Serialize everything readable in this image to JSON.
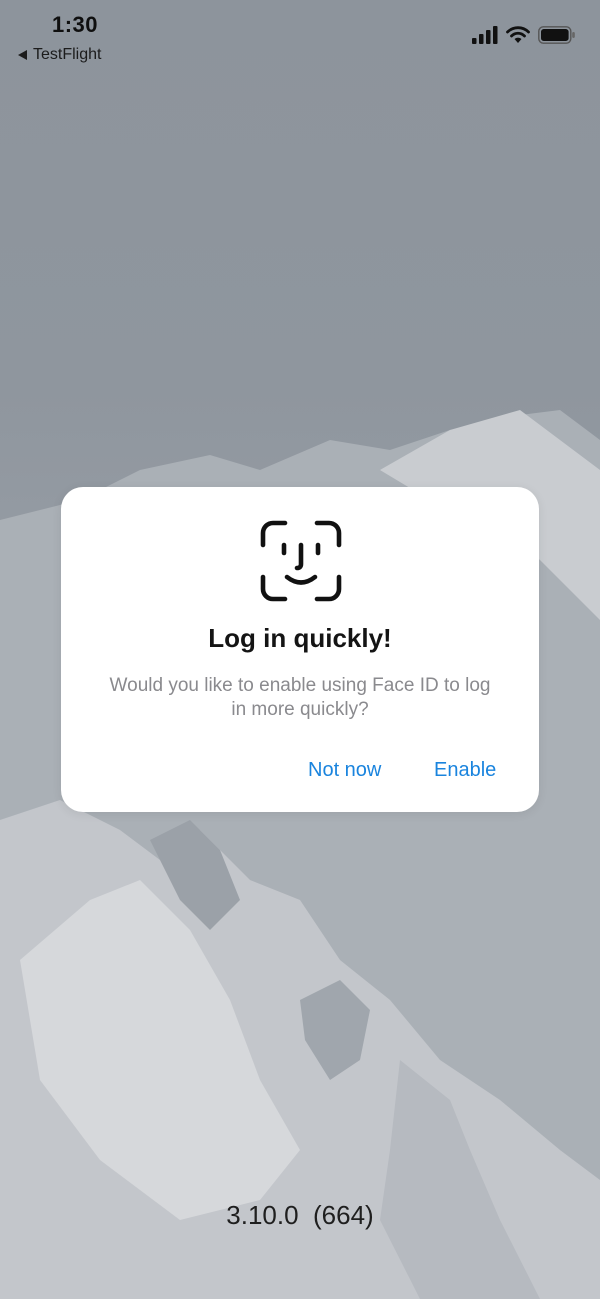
{
  "status_bar": {
    "time": "1:30",
    "back_label": "TestFlight",
    "icons": [
      "cellular-signal-icon",
      "wifi-icon",
      "battery-icon"
    ]
  },
  "dialog": {
    "icon": "face-id-icon",
    "title": "Log in quickly!",
    "message": "Would you like to enable using Face ID to log in more quickly?",
    "buttons": {
      "not_now": "Not now",
      "enable": "Enable"
    }
  },
  "footer": {
    "version": "3.10.0  (664)"
  },
  "colors": {
    "accent": "#1a84de",
    "dialog_background": "#ffffff",
    "backdrop": "#8f969e"
  }
}
